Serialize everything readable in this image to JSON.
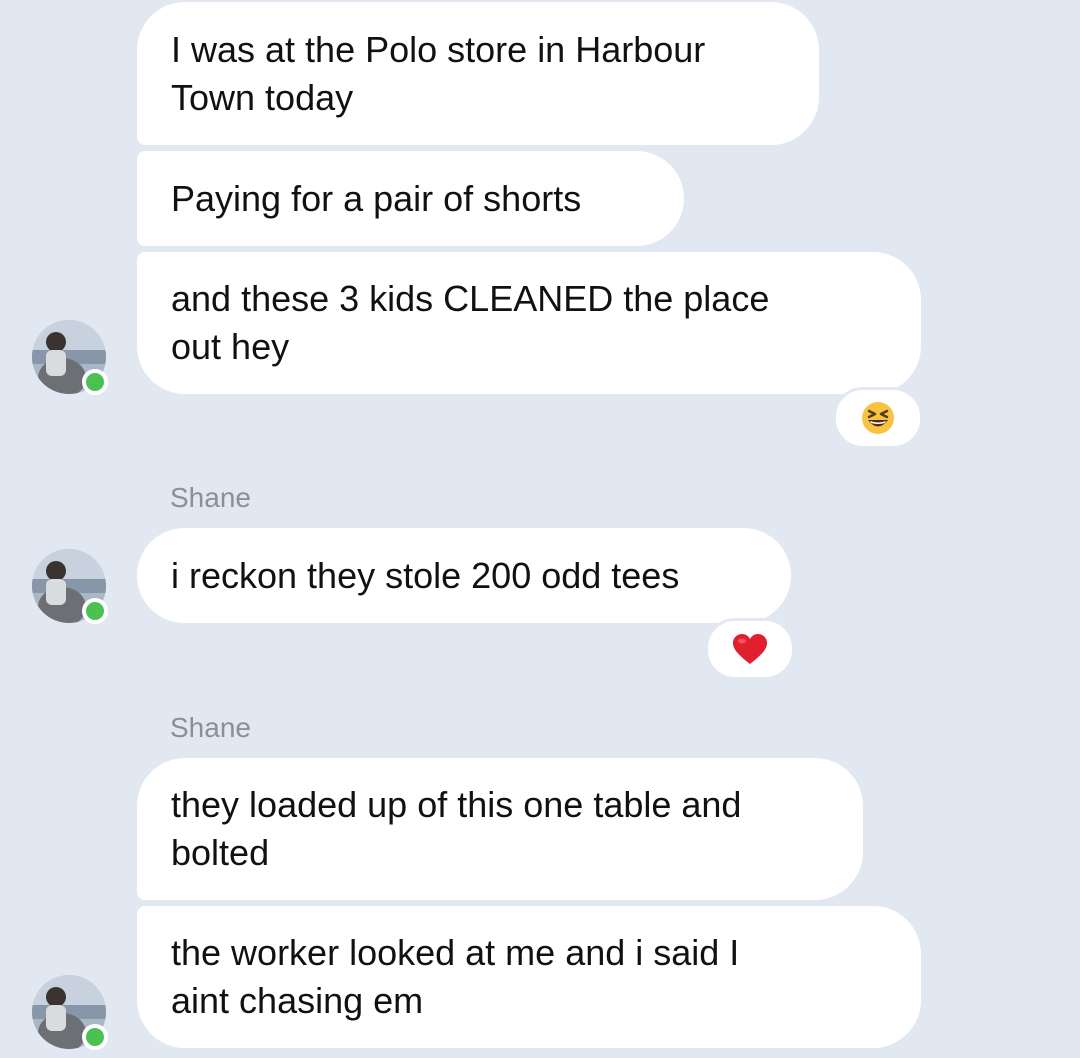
{
  "conversation": {
    "messages": [
      {
        "text": "I was at the Polo store in Harbour\nTown today"
      },
      {
        "text": "Paying for a pair of shorts"
      },
      {
        "text": "and these 3 kids CLEANED the place\nout hey",
        "reaction": "laughing-emoji"
      },
      {
        "sender": "Shane",
        "text": "i reckon they stole 200 odd tees",
        "reaction": "red-heart-emoji"
      },
      {
        "sender": "Shane",
        "text": "they loaded up of this one table and\nbolted"
      },
      {
        "text": "the worker looked at me and i  said I\naint chasing em"
      }
    ]
  },
  "colors": {
    "background": "#e2e8f2",
    "bubble": "#ffffff",
    "sender_name": "#8b8f96",
    "online_indicator": "#4cc152",
    "heart": "#e0202f",
    "emoji_face": "#f6c343"
  }
}
